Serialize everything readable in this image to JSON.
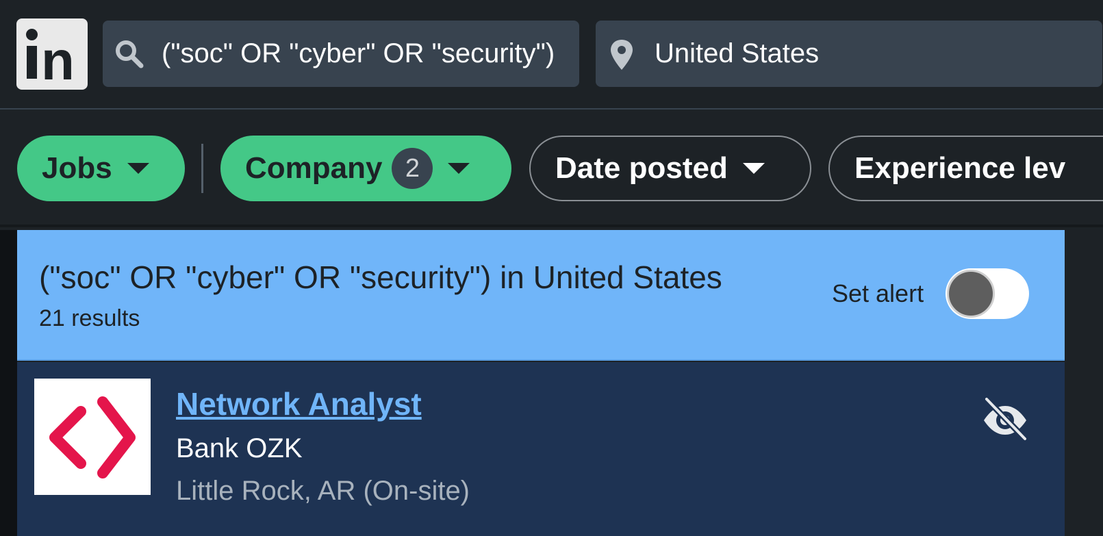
{
  "header": {
    "logo_text": "in",
    "search": {
      "value": "(\"soc\" OR \"cyber\" OR \"security\")",
      "icon": "search-icon"
    },
    "location": {
      "value": "United States",
      "icon": "location-pin-icon"
    }
  },
  "filters": {
    "jobs_label": "Jobs",
    "company_label": "Company",
    "company_count": "2",
    "date_label": "Date posted",
    "experience_label": "Experience lev"
  },
  "results": {
    "title": "(\"soc\" OR \"cyber\" OR \"security\") in United States",
    "count": "21 results",
    "alert_label": "Set alert",
    "alert_on": false
  },
  "job": {
    "title": "Network Analyst",
    "company": "Bank OZK",
    "location": "Little Rock, AR (On-site)",
    "logo_color": "#e4154b"
  },
  "colors": {
    "background": "#1d2226",
    "accent_green": "#44c887",
    "results_blue": "#70b5f9",
    "card_navy": "#1e3353"
  }
}
